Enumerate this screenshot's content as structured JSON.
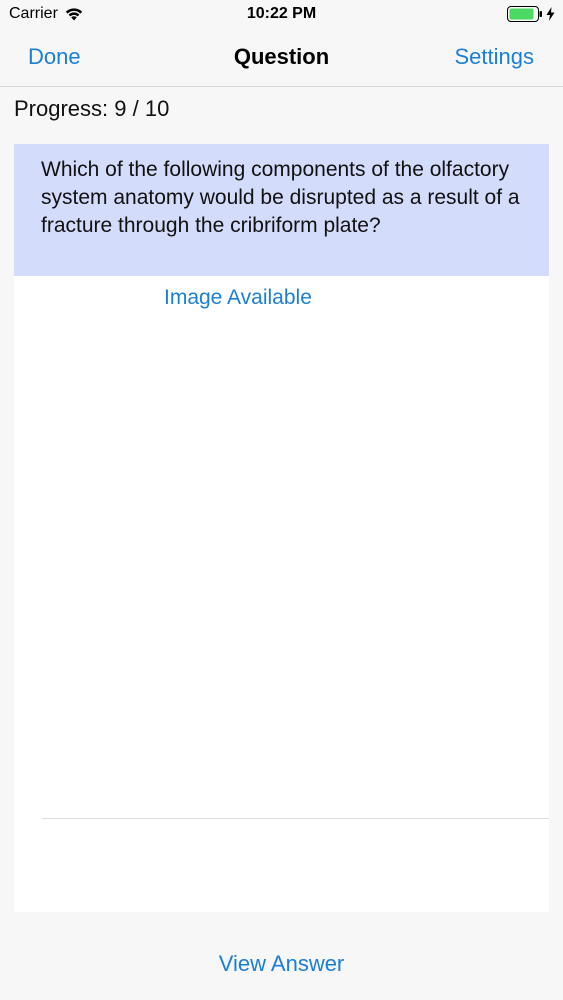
{
  "status_bar": {
    "carrier": "Carrier",
    "time": "10:22 PM",
    "icons": [
      "wifi-icon",
      "battery-icon",
      "charging-bolt-icon"
    ]
  },
  "nav": {
    "left_label": "Done",
    "title": "Question",
    "right_label": "Settings"
  },
  "progress": {
    "label": "Progress: 9 / 10",
    "current": 9,
    "total": 10
  },
  "question": {
    "text": "Which of the following components of the olfactory system anatomy would be disrupted as a result of a fracture through the cribriform plate?"
  },
  "image_link": {
    "label": "Image Available"
  },
  "footer": {
    "view_answer_label": "View Answer"
  },
  "colors": {
    "accent": "#1b7fd6",
    "question_background": "#d4dcfb",
    "battery_fill": "#4cd964"
  }
}
